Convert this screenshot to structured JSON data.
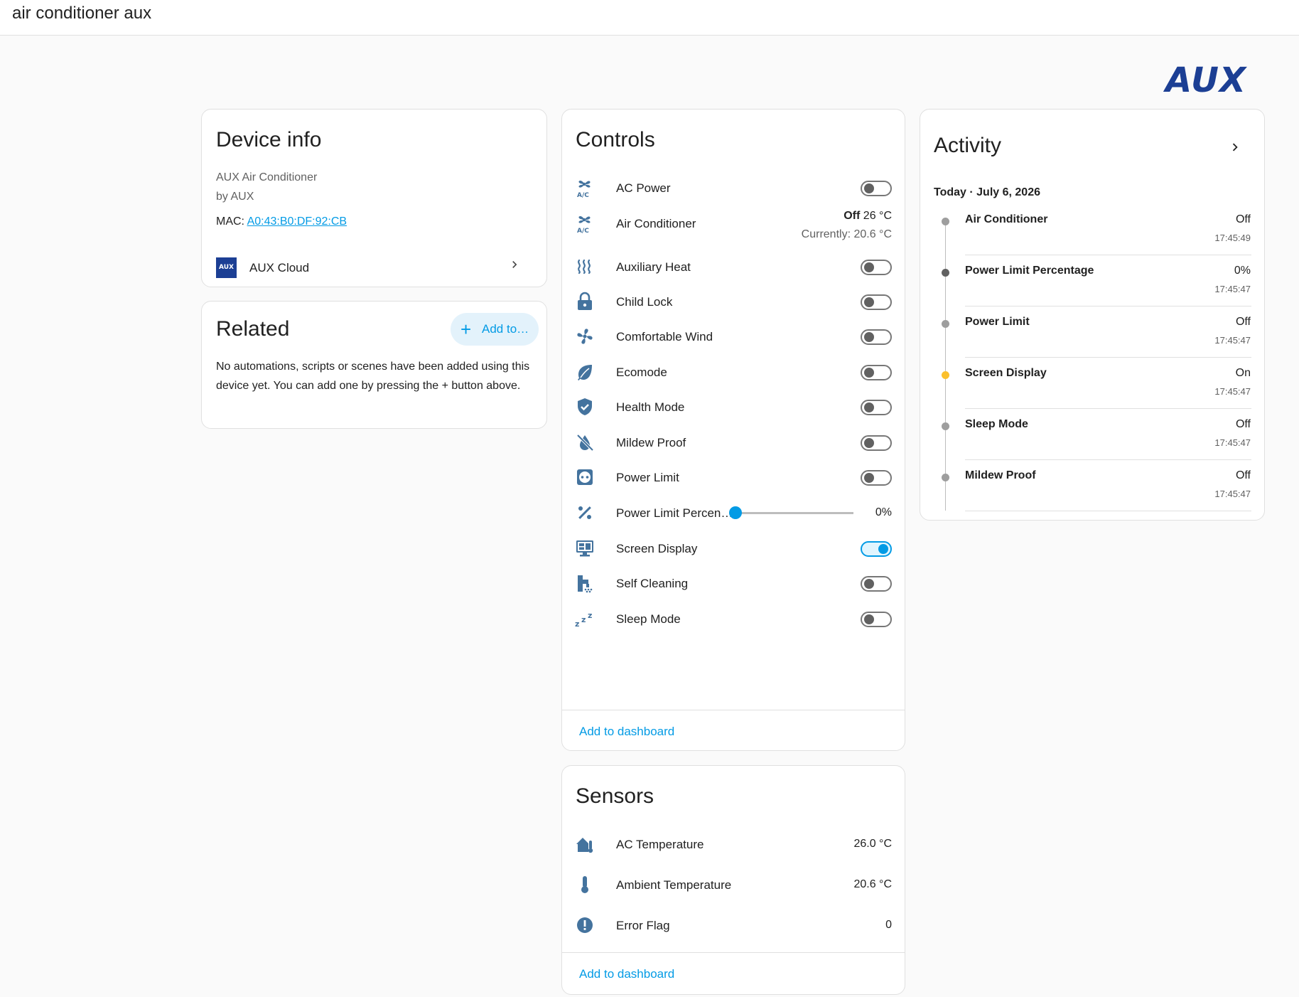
{
  "header": {
    "title": "air conditioner aux"
  },
  "brand": {
    "logo_text": "AUX",
    "color": "#1c3f94"
  },
  "accent_color": "#039be5",
  "device_info": {
    "title": "Device info",
    "model": "AUX Air Conditioner",
    "manufacturer": "by AUX",
    "mac_label": "MAC: ",
    "mac_value": "A0:43:B0:DF:92:CB",
    "integration": {
      "logo_text": "AUX",
      "label": "AUX Cloud"
    }
  },
  "related": {
    "title": "Related",
    "add_button": "Add to…",
    "empty_text": "No automations, scripts or scenes have been added using this device yet. You can add one by pressing the + button above."
  },
  "controls": {
    "title": "Controls",
    "rows": [
      {
        "label": "AC Power",
        "icon": "air-conditioner-icon",
        "type": "toggle",
        "on": false
      },
      {
        "label": "Air Conditioner",
        "icon": "air-conditioner-icon",
        "type": "climate",
        "state": "Off",
        "target": "26 °C",
        "current": "Currently: 20.6 °C"
      },
      {
        "label": "Auxiliary Heat",
        "icon": "heat-waves-icon",
        "type": "toggle",
        "on": false
      },
      {
        "label": "Child Lock",
        "icon": "lock-icon",
        "type": "toggle",
        "on": false
      },
      {
        "label": "Comfortable Wind",
        "icon": "fan-icon",
        "type": "toggle",
        "on": false
      },
      {
        "label": "Ecomode",
        "icon": "leaf-icon",
        "type": "toggle",
        "on": false
      },
      {
        "label": "Health Mode",
        "icon": "shield-check-icon",
        "type": "toggle",
        "on": false
      },
      {
        "label": "Mildew Proof",
        "icon": "water-off-icon",
        "type": "toggle",
        "on": false
      },
      {
        "label": "Power Limit",
        "icon": "power-socket-icon",
        "type": "toggle",
        "on": false
      },
      {
        "label": "Power Limit Percen…",
        "icon": "percent-icon",
        "type": "slider",
        "value": "0%",
        "fraction": 0
      },
      {
        "label": "Screen Display",
        "icon": "monitor-dashboard-icon",
        "type": "toggle",
        "on": true
      },
      {
        "label": "Self Cleaning",
        "icon": "cleaning-icon",
        "type": "toggle",
        "on": false
      },
      {
        "label": "Sleep Mode",
        "icon": "sleep-icon",
        "type": "toggle",
        "on": false
      }
    ],
    "add_to_dashboard": "Add to dashboard"
  },
  "sensors": {
    "title": "Sensors",
    "rows": [
      {
        "label": "AC Temperature",
        "icon": "home-thermometer-icon",
        "value": "26.0 °C"
      },
      {
        "label": "Ambient Temperature",
        "icon": "thermometer-icon",
        "value": "20.6 °C"
      },
      {
        "label": "Error Flag",
        "icon": "alert-circle-icon",
        "value": "0"
      }
    ],
    "add_to_dashboard": "Add to dashboard"
  },
  "activity": {
    "title": "Activity",
    "date": "Today · July 6, 2026",
    "items": [
      {
        "name": "Air Conditioner",
        "state": "Off",
        "time": "17:45:49",
        "dot_color": "#9e9e9e"
      },
      {
        "name": "Power Limit Percentage",
        "state": "0%",
        "time": "17:45:47",
        "dot_color": "#616161"
      },
      {
        "name": "Power Limit",
        "state": "Off",
        "time": "17:45:47",
        "dot_color": "#9e9e9e"
      },
      {
        "name": "Screen Display",
        "state": "On",
        "time": "17:45:47",
        "dot_color": "#fbc02d"
      },
      {
        "name": "Sleep Mode",
        "state": "Off",
        "time": "17:45:47",
        "dot_color": "#9e9e9e"
      },
      {
        "name": "Mildew Proof",
        "state": "Off",
        "time": "17:45:47",
        "dot_color": "#9e9e9e"
      }
    ]
  }
}
